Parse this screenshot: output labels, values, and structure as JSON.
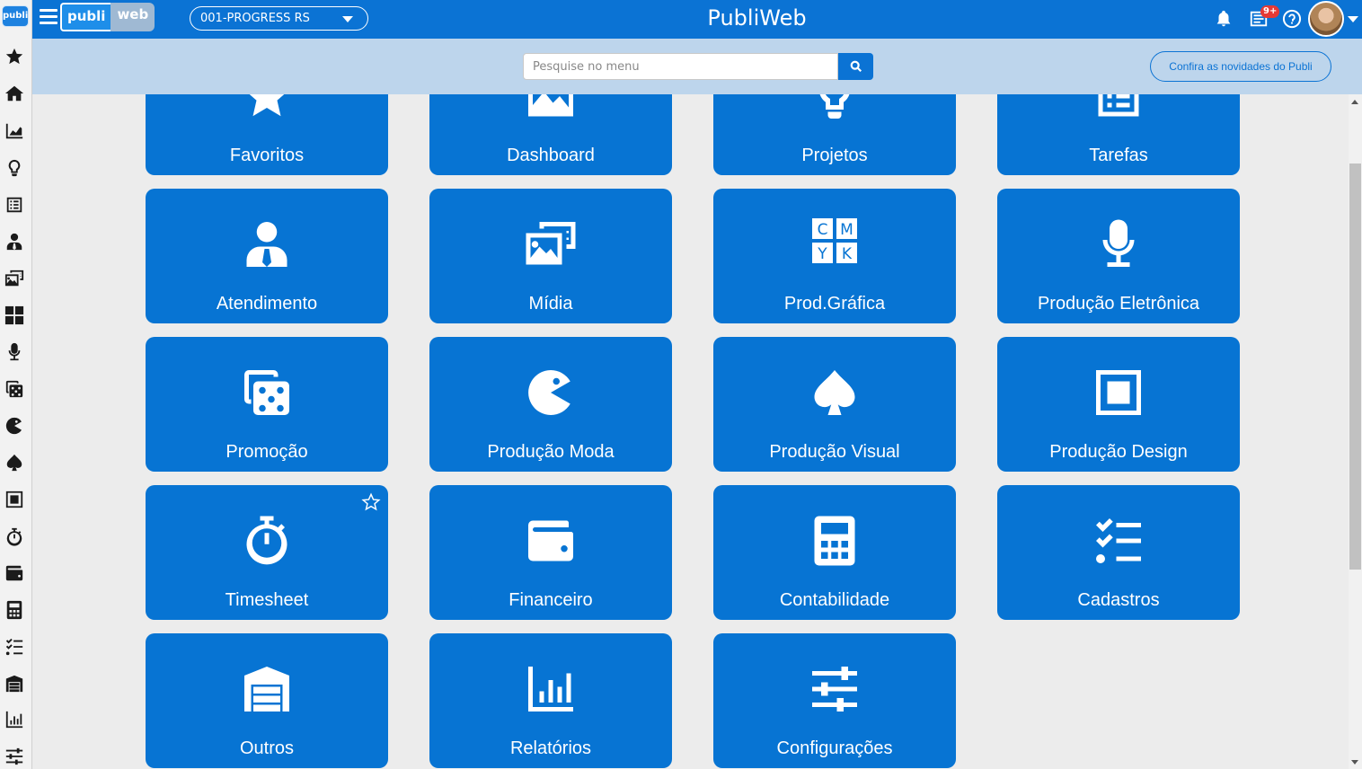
{
  "app": {
    "title": "PubliWeb",
    "logo_mini": "publi",
    "brand_part1": "publi",
    "brand_part2": "web"
  },
  "company_selector": {
    "value": "001-PROGRESS RS"
  },
  "notifications": {
    "badge": "9+"
  },
  "search": {
    "placeholder": "Pesquise no menu"
  },
  "news_button": {
    "label": "Confira as novidades do Publi"
  },
  "sidebar": {
    "icons": [
      "star-icon",
      "home-icon",
      "chart-area-icon",
      "lightbulb-icon",
      "list-icon",
      "user-tie-icon",
      "media-icon",
      "cmyk-icon",
      "microphone-icon",
      "dice-icon",
      "pacman-icon",
      "spade-icon",
      "square-icon",
      "stopwatch-icon",
      "wallet-icon",
      "calculator-icon",
      "tasks-icon",
      "warehouse-icon",
      "bar-chart-icon",
      "sliders-icon"
    ]
  },
  "tiles": [
    {
      "label": "Favoritos",
      "icon": "star-icon"
    },
    {
      "label": "Dashboard",
      "icon": "image-icon"
    },
    {
      "label": "Projetos",
      "icon": "lightbulb-icon"
    },
    {
      "label": "Tarefas",
      "icon": "list-icon"
    },
    {
      "label": "Atendimento",
      "icon": "user-tie-icon"
    },
    {
      "label": "Mídia",
      "icon": "media-icon"
    },
    {
      "label": "Prod.Gráfica",
      "icon": "cmyk-icon"
    },
    {
      "label": "Produção Eletrônica",
      "icon": "microphone-icon"
    },
    {
      "label": "Promoção",
      "icon": "dice-icon"
    },
    {
      "label": "Produção Moda",
      "icon": "pacman-icon"
    },
    {
      "label": "Produção Visual",
      "icon": "spade-icon"
    },
    {
      "label": "Produção Design",
      "icon": "square-icon"
    },
    {
      "label": "Timesheet",
      "icon": "stopwatch-icon"
    },
    {
      "label": "Financeiro",
      "icon": "wallet-icon"
    },
    {
      "label": "Contabilidade",
      "icon": "calculator-icon"
    },
    {
      "label": "Cadastros",
      "icon": "tasks-icon"
    },
    {
      "label": "Outros",
      "icon": "warehouse-icon"
    },
    {
      "label": "Relatórios",
      "icon": "bar-chart-icon"
    },
    {
      "label": "Configurações",
      "icon": "sliders-icon"
    }
  ],
  "cmyk": {
    "c": "C",
    "m": "M",
    "y": "Y",
    "k": "K"
  }
}
